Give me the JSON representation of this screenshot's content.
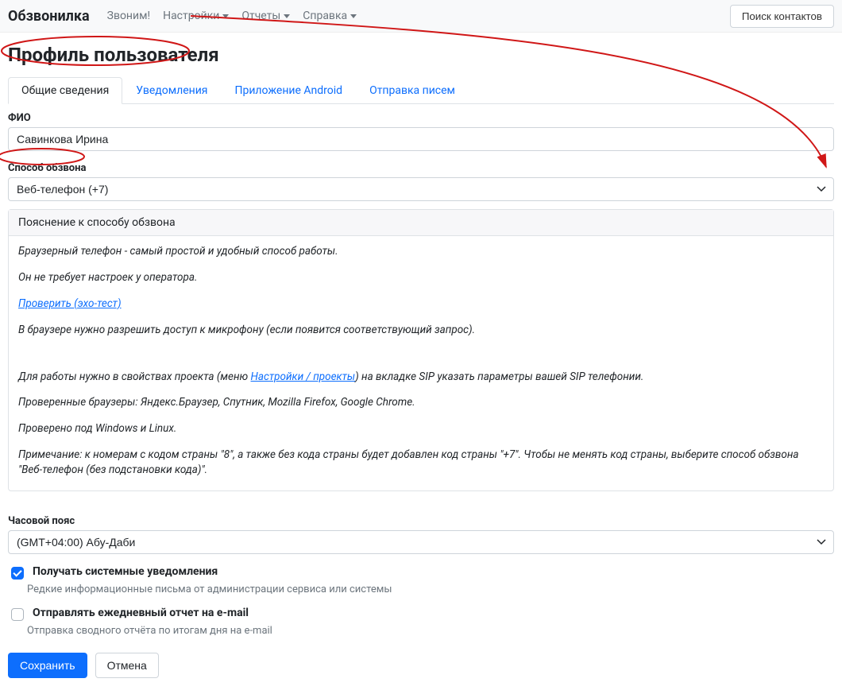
{
  "navbar": {
    "brand": "Обзвонилка",
    "links": {
      "call": "Звоним!",
      "settings": "Настройки",
      "reports": "Отчеты",
      "help": "Справка"
    },
    "search_label": "Поиск контактов"
  },
  "page": {
    "title": "Профиль пользователя"
  },
  "tabs": {
    "general": "Общие сведения",
    "notifications": "Уведомления",
    "android": "Приложение Android",
    "mail": "Отправка писем"
  },
  "form": {
    "fio_label": "ФИО",
    "fio_value": "Савинкова Ирина",
    "method_label": "Способ обзвона",
    "method_value": "Веб-телефон (+7)",
    "timezone_label": "Часовой пояс",
    "timezone_value": "(GMT+04:00) Абу-Даби",
    "sysnotify_label": "Получать системные уведомления",
    "sysnotify_help": "Редкие информационные письма от администрации сервиса или системы",
    "daily_label": "Отправлять ежедневный отчет на e-mail",
    "daily_help": "Отправка сводного отчёта по итогам дня на e-mail",
    "save": "Сохранить",
    "cancel": "Отмена"
  },
  "info": {
    "header": "Пояснение к способу обзвона",
    "p1": "Браузерный телефон - самый простой и удобный способ работы.",
    "p2": "Он не требует настроек у оператора.",
    "link1": "Проверить (эхо-тест)",
    "p3": "В браузере нужно разрешить доступ к микрофону (если появится соответствующий запрос).",
    "p4a": "Для работы нужно в свойствах проекта (меню ",
    "link2": "Настройки / проекты",
    "p4b": ") на вкладке SIP указать параметры вашей SIP телефонии.",
    "p5": "Проверенные браузеры: Яндекс.Браузер, Спутник, Mozilla Firefox,  Google Chrome.",
    "p6": "Проверено под Windows и Linux.",
    "p7": "Примечание: к номерам с кодом страны \"8\", а также без кода страны будет добавлен код страны \"+7\". Чтобы не менять код страны, выберите способ обзвона \"Веб-телефон (без подстановки кода)\"."
  }
}
